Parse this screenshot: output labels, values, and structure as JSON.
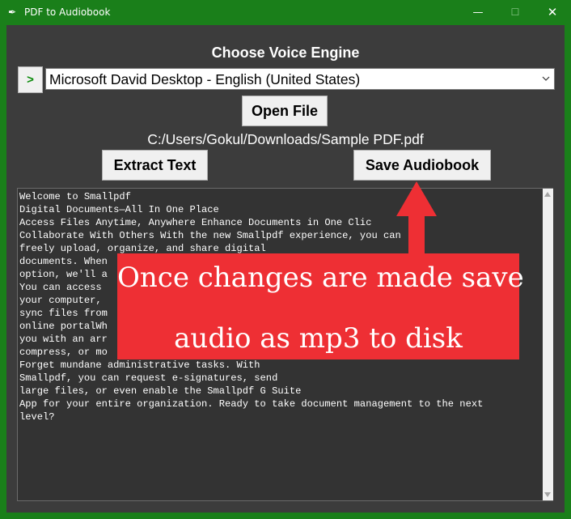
{
  "window": {
    "title": "PDF to Audiobook",
    "controls": {
      "minimize": "—",
      "maximize": "☐",
      "close": "✕"
    }
  },
  "colors": {
    "titlebar": "#1a7f1a",
    "client_bg": "#3c3c3c",
    "annotation": "#ee2f34"
  },
  "header": {
    "title": "Choose Voice Engine"
  },
  "voice": {
    "toggle_label": ">",
    "selected": "Microsoft David Desktop - English (United States)"
  },
  "buttons": {
    "open_file": "Open File",
    "extract_text": "Extract Text",
    "save_audiobook": "Save Audiobook"
  },
  "file": {
    "path": "C:/Users/Gokul/Downloads/Sample PDF.pdf"
  },
  "text_area": {
    "lines": [
      "Welcome to Smallpdf",
      "Digital Documents—All In One Place",
      "Access Files Anytime, Anywhere Enhance Documents in One Clic",
      "Collaborate With Others With the new Smallpdf experience, you can",
      "freely upload, organize, and share digital",
      "documents. When",
      "option, we'll a",
      "You can access",
      "your computer,",
      "sync files from",
      "online portalWh",
      "you with an arr",
      "compress, or mo",
      "Forget mundane administrative tasks. With",
      "Smallpdf, you can request e-signatures, send",
      "large files, or even enable the Smallpdf G Suite",
      "App for your entire organization. Ready to take document management to the next",
      "level?"
    ]
  },
  "annotation": {
    "line1": "Once changes are made save",
    "line2": "audio as mp3 to disk"
  }
}
